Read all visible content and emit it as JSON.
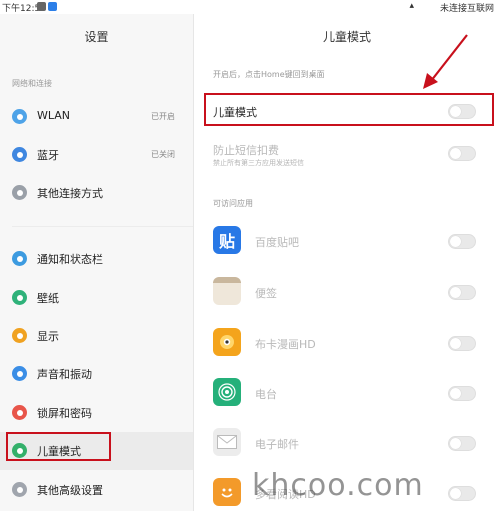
{
  "status_bar": {
    "time": "下午12:55",
    "network": "未连接互联网"
  },
  "left": {
    "title": "设置",
    "section_label": "网络和连接",
    "items": [
      {
        "label": "WLAN",
        "value": "已开启",
        "color": "#4ea3e8"
      },
      {
        "label": "蓝牙",
        "value": "已关闭",
        "color": "#3f87e0"
      },
      {
        "label": "其他连接方式",
        "value": "",
        "color": "#9aa0a8"
      },
      {
        "label": "通知和状态栏",
        "value": "",
        "color": "#3d9be0"
      },
      {
        "label": "壁纸",
        "value": "",
        "color": "#2fb27a"
      },
      {
        "label": "显示",
        "value": "",
        "color": "#f0a221"
      },
      {
        "label": "声音和振动",
        "value": "",
        "color": "#3b8ee6"
      },
      {
        "label": "锁屏和密码",
        "value": "",
        "color": "#e8554a"
      },
      {
        "label": "儿童模式",
        "value": "",
        "color": "#33b06a"
      },
      {
        "label": "其他高级设置",
        "value": "",
        "color": "#a0a5ad"
      }
    ]
  },
  "right": {
    "title": "儿童模式",
    "hint": "开启后，点击Home键回到桌面",
    "kid_mode_label": "儿童模式",
    "sms_label": "防止短信扣费",
    "sms_sub": "禁止所有第三方应用发送短信",
    "apps_section": "可访问应用",
    "apps": [
      {
        "label": "百度贴吧",
        "icon": "tieba-icon",
        "glyph": "贴",
        "color": "#2878e6"
      },
      {
        "label": "便签",
        "icon": "notes-icon",
        "glyph": "",
        "color": "#e6d7c3"
      },
      {
        "label": "布卡漫画HD",
        "icon": "buka-icon",
        "glyph": "",
        "color": "#f4a41c"
      },
      {
        "label": "电台",
        "icon": "radio-icon",
        "glyph": "",
        "color": "#25b07a"
      },
      {
        "label": "电子邮件",
        "icon": "email-icon",
        "glyph": "",
        "color": "#e4e4e4"
      },
      {
        "label": "多看阅读HD",
        "icon": "duokan-icon",
        "glyph": "",
        "color": "#f39a2a"
      }
    ]
  },
  "watermark": "khcoo.com"
}
